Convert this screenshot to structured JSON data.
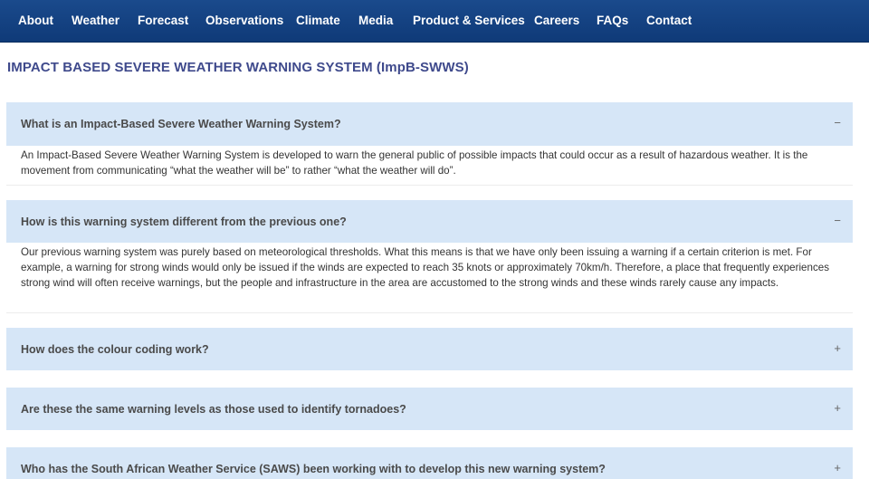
{
  "nav": {
    "items": [
      {
        "label": "About"
      },
      {
        "label": "Weather"
      },
      {
        "label": "Forecast"
      },
      {
        "label": "Observations"
      },
      {
        "label": "Climate"
      },
      {
        "label": "Media"
      },
      {
        "label": "Product & Services"
      },
      {
        "label": "Careers"
      },
      {
        "label": "FAQs"
      },
      {
        "label": "Contact"
      }
    ],
    "colors": {
      "bar": "#1a4a8c",
      "text": "#ffffff"
    }
  },
  "page": {
    "title": "IMPACT BASED SEVERE WEATHER WARNING SYSTEM (ImpB-SWWS)",
    "title_color": "#3f4a8c"
  },
  "accordion": {
    "header_color": "#d6e6f7",
    "items": [
      {
        "question": "What is an Impact-Based Severe Weather Warning System?",
        "toggle": "−",
        "expanded": true,
        "answer": "An Impact-Based Severe Weather Warning System is developed to warn the general public of possible impacts that could occur as a result of hazardous weather. It is the movement from communicating “what the weather will be” to rather “what the weather will do”."
      },
      {
        "question": "How is this warning system different from the previous one?",
        "toggle": "−",
        "expanded": true,
        "answer": "Our previous warning system was purely based on meteorological thresholds. What this means is that we have only been issuing a warning if a certain criterion is met. For example, a warning for strong winds would only be issued if the winds are expected to reach 35 knots or approximately 70km/h. Therefore, a place that frequently experiences strong wind will often receive warnings, but the people and infrastructure in the area are accustomed to the strong winds and these winds rarely cause any impacts."
      },
      {
        "question": "How does the colour coding work?",
        "toggle": "+",
        "expanded": false
      },
      {
        "question": "Are these the same warning levels as those used to identify tornadoes?",
        "toggle": "+",
        "expanded": false
      },
      {
        "question": "Who has the South African Weather Service (SAWS) been working with to develop this new warning system?",
        "toggle": "+",
        "expanded": false
      }
    ]
  }
}
